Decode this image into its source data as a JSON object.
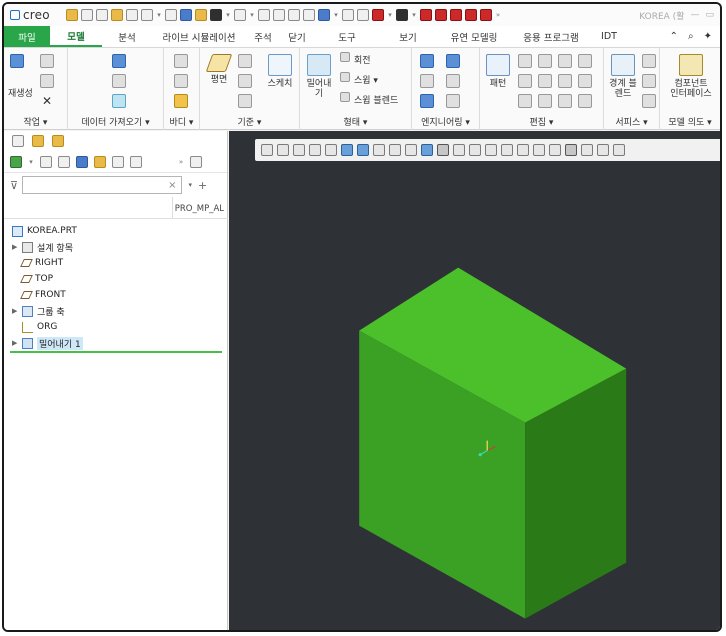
{
  "app": {
    "logo_text": "creo",
    "title_text": "KOREA (활"
  },
  "tabs": [
    {
      "label": "파일"
    },
    {
      "label": "모델"
    },
    {
      "label": "분석"
    },
    {
      "label": "라이브 시뮬레이션"
    },
    {
      "label": "주석"
    },
    {
      "label": "닫기"
    },
    {
      "label": "도구"
    },
    {
      "label": "보기"
    },
    {
      "label": "유연 모델링"
    },
    {
      "label": "응용 프로그램"
    },
    {
      "label": "IDT"
    }
  ],
  "ribbon": {
    "groups": [
      {
        "label": "작업 ▾"
      },
      {
        "label": "데이터 가져오기 ▾"
      },
      {
        "label": "바디 ▾"
      },
      {
        "label": "기준 ▾"
      },
      {
        "label": "형태 ▾"
      },
      {
        "label": "엔지니어링 ▾"
      },
      {
        "label": "편집 ▾"
      },
      {
        "label": "서피스 ▾"
      },
      {
        "label": "모델 의도 ▾"
      }
    ],
    "buttons": {
      "regenerate": "재생성",
      "plane": "평면",
      "sketch": "스케치",
      "extrude": "밀어내\n기",
      "revolve": "회전",
      "sweep": "스윕 ▾",
      "swept_blend": "스윕 블렌드",
      "pattern": "패턴",
      "boundary_blend": "경계 블\n렌드",
      "component_interface": "컴포넌트\n인터페이스"
    }
  },
  "model_tree": {
    "search_placeholder": "",
    "column_header": "PRO_MP_AL",
    "items": [
      {
        "label": "KOREA.PRT",
        "icon": "part-icon"
      },
      {
        "label": "설계 항목",
        "icon": "design-items-icon"
      },
      {
        "label": "RIGHT",
        "icon": "datum-plane-icon"
      },
      {
        "label": "TOP",
        "icon": "datum-plane-icon"
      },
      {
        "label": "FRONT",
        "icon": "datum-plane-icon"
      },
      {
        "label": "그룹 축",
        "icon": "group-icon"
      },
      {
        "label": "ORG",
        "icon": "csys-icon"
      },
      {
        "label": "밀어내기 1",
        "icon": "extrude-icon",
        "selected": true
      }
    ]
  },
  "colors": {
    "accent": "#2aa64a",
    "model_front": "#3aa124",
    "model_top": "#4cc02a",
    "model_side": "#2a7a18",
    "background": "#2e3236"
  }
}
